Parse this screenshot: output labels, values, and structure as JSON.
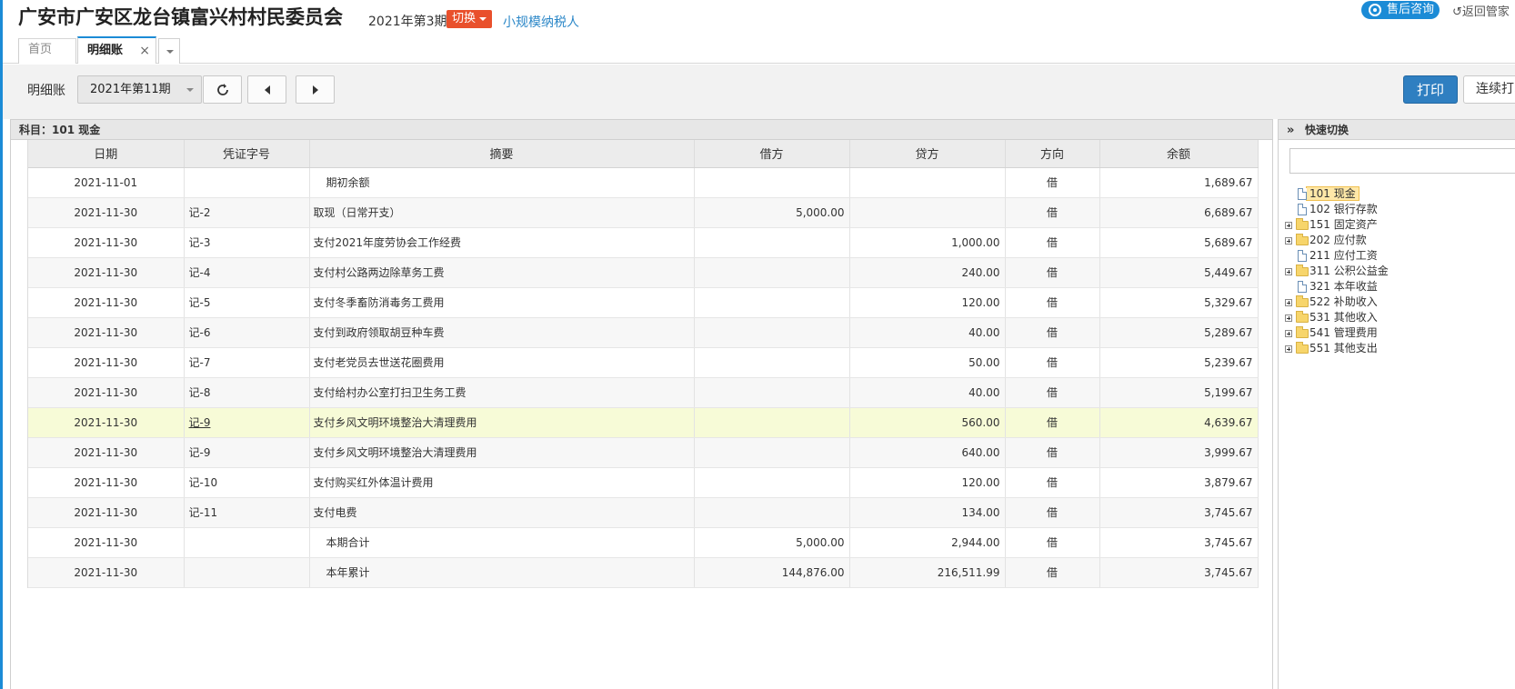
{
  "header": {
    "company": "广安市广安区龙台镇富兴村村民委员会",
    "period": "2021年第3期",
    "switch_label": "切换",
    "taxpayer": "小规模纳税人",
    "consult_label": "售后咨询",
    "return_label": "返回管家"
  },
  "tabs": {
    "home": "首页",
    "active": "明细账",
    "close_glyph": "×"
  },
  "toolbar": {
    "label": "明细账",
    "period_select": "2021年第11期",
    "print_label": "打印",
    "continuous_label": "连续打印"
  },
  "ledger": {
    "subject": "科目：101  现金",
    "columns": {
      "date": "日期",
      "voucher": "凭证字号",
      "summary": "摘要",
      "debit": "借方",
      "credit": "贷方",
      "direction": "方向",
      "balance": "余额"
    },
    "rows": [
      {
        "date": "2021-11-01",
        "voucher": "",
        "summary": "期初余额",
        "debit": "",
        "credit": "",
        "direction": "借",
        "balance": "1,689.67"
      },
      {
        "date": "2021-11-30",
        "voucher": "记-2",
        "summary": "取现（日常开支）",
        "debit": "5,000.00",
        "credit": "",
        "direction": "借",
        "balance": "6,689.67"
      },
      {
        "date": "2021-11-30",
        "voucher": "记-3",
        "summary": "支付2021年度劳协会工作经费",
        "debit": "",
        "credit": "1,000.00",
        "direction": "借",
        "balance": "5,689.67"
      },
      {
        "date": "2021-11-30",
        "voucher": "记-4",
        "summary": "支付村公路两边除草务工费",
        "debit": "",
        "credit": "240.00",
        "direction": "借",
        "balance": "5,449.67"
      },
      {
        "date": "2021-11-30",
        "voucher": "记-5",
        "summary": "支付冬季畜防消毒务工费用",
        "debit": "",
        "credit": "120.00",
        "direction": "借",
        "balance": "5,329.67"
      },
      {
        "date": "2021-11-30",
        "voucher": "记-6",
        "summary": "支付到政府领取胡豆种车费",
        "debit": "",
        "credit": "40.00",
        "direction": "借",
        "balance": "5,289.67"
      },
      {
        "date": "2021-11-30",
        "voucher": "记-7",
        "summary": "支付老党员去世送花圈费用",
        "debit": "",
        "credit": "50.00",
        "direction": "借",
        "balance": "5,239.67"
      },
      {
        "date": "2021-11-30",
        "voucher": "记-8",
        "summary": "支付给村办公室打扫卫生务工费",
        "debit": "",
        "credit": "40.00",
        "direction": "借",
        "balance": "5,199.67"
      },
      {
        "date": "2021-11-30",
        "voucher": "记-9",
        "summary": "支付乡风文明环境整治大清理费用",
        "debit": "",
        "credit": "560.00",
        "direction": "借",
        "balance": "4,639.67"
      },
      {
        "date": "2021-11-30",
        "voucher": "记-9",
        "summary": "支付乡风文明环境整治大清理费用",
        "debit": "",
        "credit": "640.00",
        "direction": "借",
        "balance": "3,999.67"
      },
      {
        "date": "2021-11-30",
        "voucher": "记-10",
        "summary": "支付购买红外体温计费用",
        "debit": "",
        "credit": "120.00",
        "direction": "借",
        "balance": "3,879.67"
      },
      {
        "date": "2021-11-30",
        "voucher": "记-11",
        "summary": "支付电费",
        "debit": "",
        "credit": "134.00",
        "direction": "借",
        "balance": "3,745.67"
      },
      {
        "date": "2021-11-30",
        "voucher": "",
        "summary": "本期合计",
        "debit": "5,000.00",
        "credit": "2,944.00",
        "direction": "借",
        "balance": "3,745.67"
      },
      {
        "date": "2021-11-30",
        "voucher": "",
        "summary": "本年累计",
        "debit": "144,876.00",
        "credit": "216,511.99",
        "direction": "借",
        "balance": "3,745.67"
      }
    ]
  },
  "quick": {
    "title": "快速切换",
    "arrows": "»",
    "items": [
      {
        "code": "101 现金",
        "type": "doc",
        "expandable": false,
        "selected": true
      },
      {
        "code": "102 银行存款",
        "type": "doc",
        "expandable": false,
        "selected": false
      },
      {
        "code": "151 固定资产",
        "type": "folder",
        "expandable": true,
        "selected": false
      },
      {
        "code": "202 应付款",
        "type": "folder",
        "expandable": true,
        "selected": false
      },
      {
        "code": "211 应付工资",
        "type": "doc",
        "expandable": false,
        "selected": false
      },
      {
        "code": "311 公积公益金",
        "type": "folder",
        "expandable": true,
        "selected": false
      },
      {
        "code": "321 本年收益",
        "type": "doc",
        "expandable": false,
        "selected": false
      },
      {
        "code": "522 补助收入",
        "type": "folder",
        "expandable": true,
        "selected": false
      },
      {
        "code": "531 其他收入",
        "type": "folder",
        "expandable": true,
        "selected": false
      },
      {
        "code": "541 管理费用",
        "type": "folder",
        "expandable": true,
        "selected": false
      },
      {
        "code": "551 其他支出",
        "type": "folder",
        "expandable": true,
        "selected": false
      }
    ]
  }
}
